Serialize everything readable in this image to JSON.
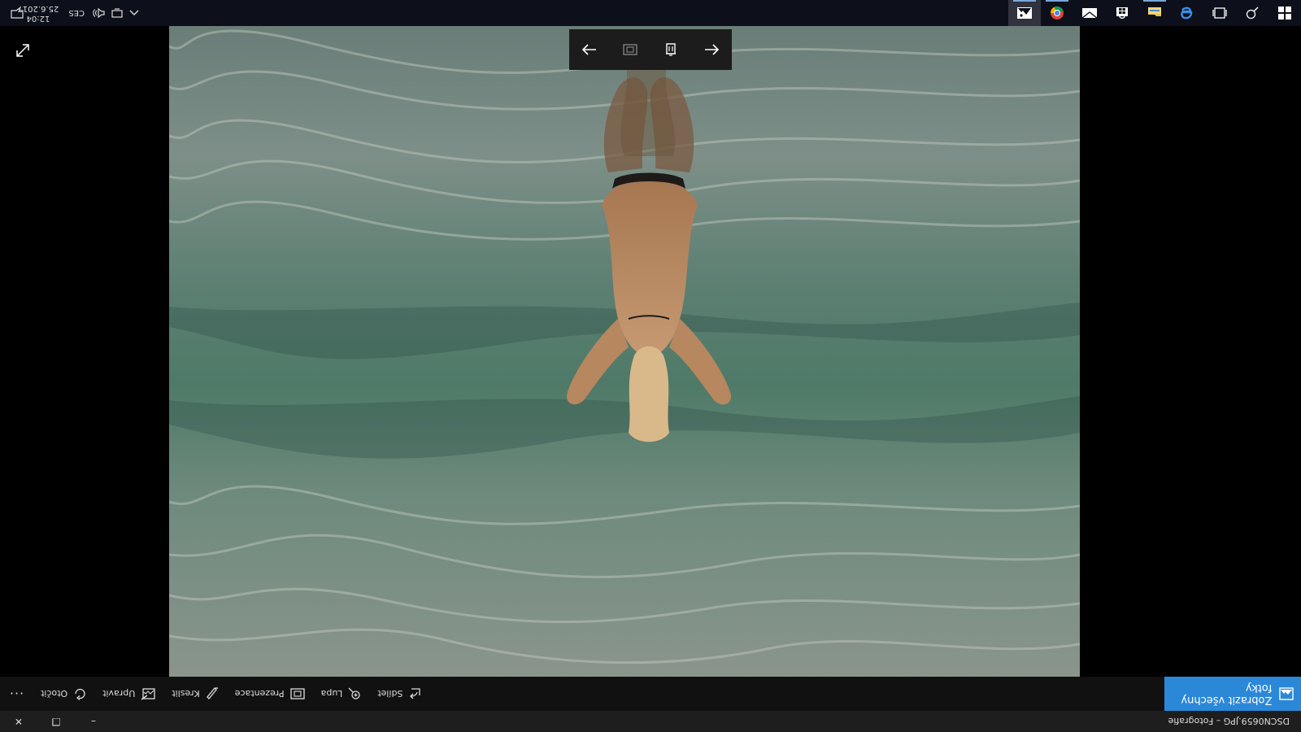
{
  "window": {
    "title": "DSCN0659.JPG – Fotografie",
    "minimize_glyph": "–",
    "restore_glyph": "❐",
    "close_glyph": "✕"
  },
  "command_bar": {
    "show_all_label": "Zobrazit všechny fotky",
    "items": [
      {
        "label": "Sdílet",
        "icon": "share-icon"
      },
      {
        "label": "Lupa",
        "icon": "zoom-icon"
      },
      {
        "label": "Prezentace",
        "icon": "slideshow-icon"
      },
      {
        "label": "Kreslit",
        "icon": "draw-icon"
      },
      {
        "label": "Upravit",
        "icon": "edit-icon"
      },
      {
        "label": "Otočit",
        "icon": "rotate-icon"
      }
    ],
    "more_glyph": "···"
  },
  "photo": {
    "subject": "beach-photo",
    "colors": {
      "sea_top": "#7f8c83",
      "sea_mid": "#4f7a68",
      "foam": "#b9c2b8"
    }
  },
  "viewer_nav": {
    "icons": [
      "arrow-left-icon",
      "delete-icon",
      "fit-icon",
      "arrow-right-icon"
    ]
  },
  "taskbar": {
    "apps": [
      "start-icon",
      "search-icon",
      "task-view-icon",
      "edge-icon",
      "file-explorer-icon",
      "store-icon",
      "mail-icon",
      "chrome-icon",
      "photos-icon"
    ],
    "tray": {
      "language": "CES",
      "time": "12:04",
      "date": "25.6.2017"
    }
  },
  "colors": {
    "accent": "#2b88d8",
    "taskbar": "#0d0f1a",
    "titlebar": "#1e1e1e"
  }
}
